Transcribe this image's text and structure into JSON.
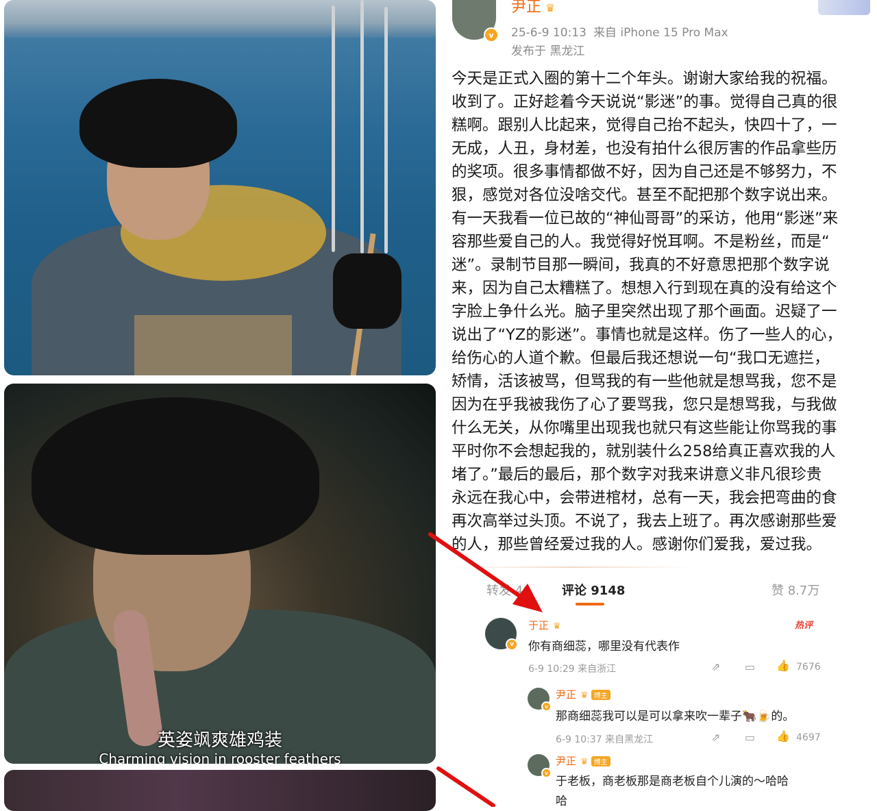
{
  "left_stills": {
    "subtitle_cn": "英姿飒爽雄鸡装",
    "subtitle_en": "Charming vision in rooster feathers"
  },
  "post": {
    "author": "尹正",
    "date": "25-6-9 10:13",
    "device": "来自 iPhone 15 Pro Max",
    "location": "发布于 黑龙江",
    "lines": [
      "今天是正式入圈的第十二个年头。谢谢大家给我的祝福。",
      "收到了。正好趁着今天说说“影迷”的事。觉得自己真的很",
      "糕啊。跟别人比起来，觉得自己抬不起头，快四十了，一",
      "无成，人丑，身材差，也没有拍什么很厉害的作品拿些历",
      "的奖项。很多事情都做不好，因为自己还是不够努力，不",
      "狠，感觉对各位没啥交代。甚至不配把那个数字说出来。",
      "有一天我看一位已故的“神仙哥哥”的采访，他用“影迷”来",
      "容那些爱自己的人。我觉得好悦耳啊。不是粉丝，而是“",
      "迷”。录制节目那一瞬间，我真的不好意思把那个数字说",
      "来，因为自己太糟糕了。想想入行到现在真的没有给这个",
      "字脸上争什么光。脑子里突然出现了那个画面。迟疑了一",
      "说出了“YZ的影迷”。事情也就是这样。伤了一些人的心，",
      "给伤心的人道个歉。但最后我还想说一句“我口无遮拦，",
      "矫情，活该被骂，但骂我的有一些他就是想骂我，您不是",
      "因为在乎我被我伤了心了要骂我，您只是想骂我，与我做",
      "什么无关，从你嘴里出现我也就只有这些能让你骂我的事",
      "平时你不会想起我的，就别装什么258给真正喜欢我的人",
      "堵了。”最后的最后，那个数字对我来讲意义非凡很珍贵",
      "永远在我心中，会带进棺材，总有一天，我会把弯曲的食",
      "再次高举过头顶。不说了，我去上班了。再次感谢那些爱",
      "的人，那些曾经爱过我的人。感谢你们爱我，爱过我。"
    ]
  },
  "stats": {
    "repost": "转发 46",
    "comments": "评论 9148",
    "likes": "赞 8.7万"
  },
  "comments": [
    {
      "name": "于正",
      "text": "你有商细蕊，哪里没有代表作",
      "meta": "6-9 10:29  来自浙江",
      "likes": "7676",
      "hot": "热评"
    },
    {
      "name": "尹正",
      "tag": "博主",
      "text": "那商细蕊我可以是可以拿来吹一辈子🐂🍺的。",
      "meta": "6-9 10:37  来自黑龙江",
      "likes": "4697"
    },
    {
      "name": "尹正",
      "tag": "博主",
      "text_line1": "于老板，商老板那是商老板自个儿演的～哈哈",
      "text_line2": "哈"
    }
  ],
  "colors": {
    "accent": "#f06a14",
    "arrow": "#e01010",
    "meta": "#8a8a8a"
  }
}
